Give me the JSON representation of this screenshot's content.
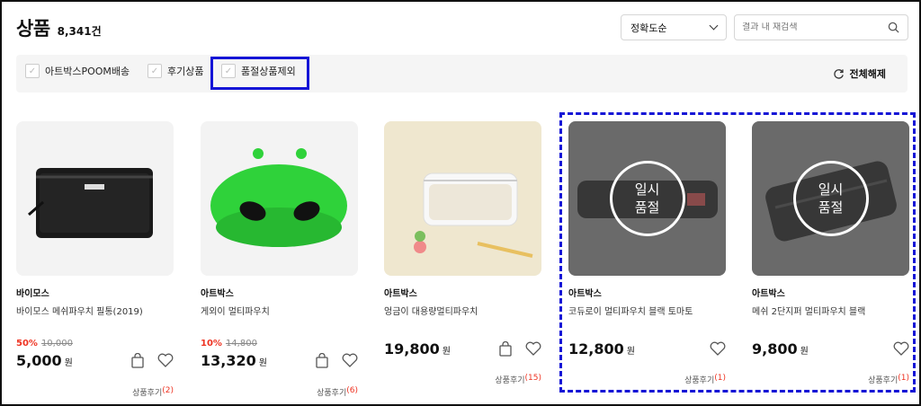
{
  "header": {
    "title": "상품",
    "count": "8,341건"
  },
  "sort": {
    "selected": "정확도순"
  },
  "search": {
    "placeholder": "결과 내 재검색"
  },
  "filters": [
    {
      "label": "아트박스POOM배송"
    },
    {
      "label": "후기상품"
    },
    {
      "label": "품절상품제외"
    }
  ],
  "reset_label": "전체해제",
  "products": [
    {
      "brand": "바이모스",
      "name": "바이모스 메쉬파우치 필통(2019)",
      "discount_rate": "50%",
      "original_price": "10,000",
      "price": "5,000",
      "currency": "원",
      "review_label": "상품후기",
      "review_count": "(2)",
      "sold_out": ""
    },
    {
      "brand": "아트박스",
      "name": "게외이 멀티파우치",
      "discount_rate": "10%",
      "original_price": "14,800",
      "price": "13,320",
      "currency": "원",
      "review_label": "상품후기",
      "review_count": "(6)",
      "sold_out": ""
    },
    {
      "brand": "아트박스",
      "name": "엉금이 대용량멀티파우치",
      "discount_rate": "",
      "original_price": "",
      "price": "19,800",
      "currency": "원",
      "review_label": "상품후기",
      "review_count": "(15)",
      "sold_out": ""
    },
    {
      "brand": "아트박스",
      "name": "코듀로이 멀티파우치 블랙 토마토",
      "discount_rate": "",
      "original_price": "",
      "price": "12,800",
      "currency": "원",
      "review_label": "상품후기",
      "review_count": "(1)",
      "sold_out": "일시 품절"
    },
    {
      "brand": "아트박스",
      "name": "메쉬 2단지퍼 멀티파우치 블랙",
      "discount_rate": "",
      "original_price": "",
      "price": "9,800",
      "currency": "원",
      "review_label": "상품후기",
      "review_count": "(1)",
      "sold_out": "일시 품절"
    }
  ],
  "soldout_line1": "일시",
  "soldout_line2": "품절",
  "colors": {
    "highlight": "#1515d6",
    "discount": "#e32222",
    "alien_green": "#2fd23a"
  }
}
